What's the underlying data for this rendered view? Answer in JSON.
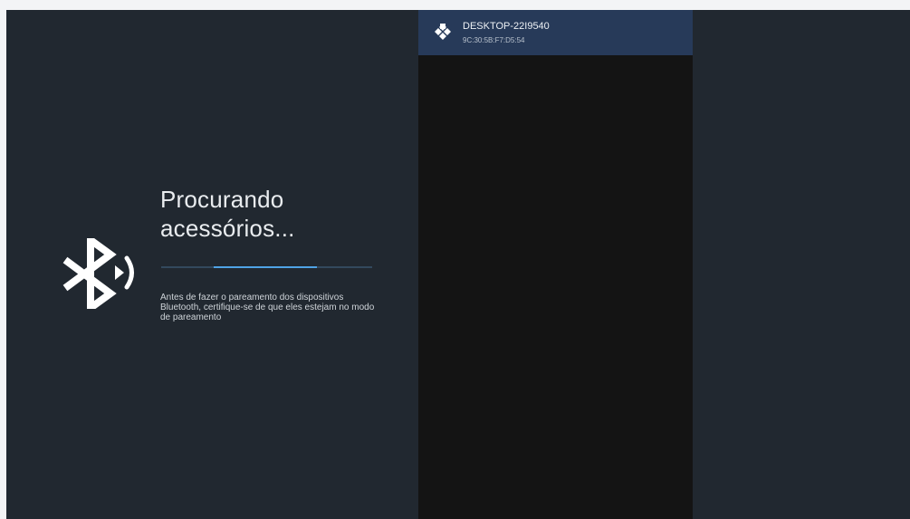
{
  "scan": {
    "title_line1": "Procurando",
    "title_line2": "acessórios...",
    "progress": {
      "start_fraction": 0.25,
      "end_fraction": 0.74
    },
    "hint": "Antes de fazer o pareamento dos dispositivos Bluetooth, certifique-se de que eles estejam no modo de pareamento",
    "icon": "bluetooth-searching-icon"
  },
  "devices": [
    {
      "name": "DESKTOP-22I9540",
      "mac": "9C:30:5B:F7:D5:54",
      "icon": "gamepad-icon"
    }
  ],
  "colors": {
    "background": "#212830",
    "list_background": "#141414",
    "selected_row": "#273a59",
    "progress_fill": "#4fa3e6",
    "progress_track": "#33495d"
  }
}
